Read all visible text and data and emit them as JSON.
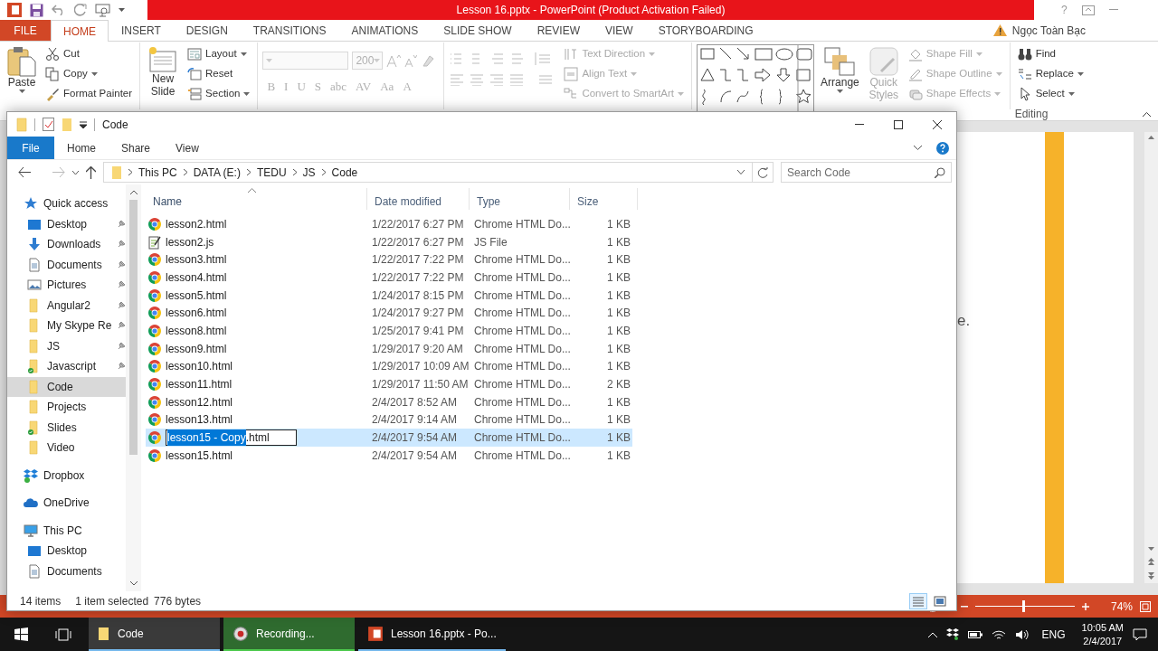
{
  "powerpoint": {
    "title": "Lesson 16.pptx - PowerPoint (Product Activation Failed)",
    "help": "?",
    "tabs": [
      {
        "label": "FILE",
        "kind": "backstage",
        "selected": false
      },
      {
        "label": "HOME",
        "kind": "tab",
        "selected": true
      },
      {
        "label": "INSERT",
        "kind": "tab",
        "selected": false
      },
      {
        "label": "DESIGN",
        "kind": "tab",
        "selected": false
      },
      {
        "label": "TRANSITIONS",
        "kind": "tab",
        "selected": false
      },
      {
        "label": "ANIMATIONS",
        "kind": "tab",
        "selected": false
      },
      {
        "label": "SLIDE SHOW",
        "kind": "tab",
        "selected": false
      },
      {
        "label": "REVIEW",
        "kind": "tab",
        "selected": false
      },
      {
        "label": "VIEW",
        "kind": "tab",
        "selected": false
      },
      {
        "label": "STORYBOARDING",
        "kind": "tab",
        "selected": false
      }
    ],
    "account": {
      "name": "Ngọc Toàn Bạc",
      "warning": true
    },
    "ribbon": {
      "clipboard": {
        "paste": "Paste",
        "commands": [
          {
            "label": "Cut",
            "kind": "cut",
            "menu": false,
            "disabled": false
          },
          {
            "label": "Copy",
            "kind": "copy",
            "menu": true,
            "disabled": false
          },
          {
            "label": "Format Painter",
            "kind": "brush",
            "menu": false,
            "disabled": false
          }
        ]
      },
      "slides": {
        "new_slide": "New Slide",
        "commands": [
          {
            "label": "Layout",
            "kind": "layout",
            "menu": true,
            "disabled": false
          },
          {
            "label": "Reset",
            "kind": "reset",
            "menu": false,
            "disabled": false
          },
          {
            "label": "Section",
            "kind": "section",
            "menu": true,
            "disabled": false
          }
        ]
      },
      "font": {
        "disabled": true,
        "size": "200",
        "formats": [
          "B",
          "I",
          "U",
          "S",
          "abc",
          "AV",
          "Aa",
          "A"
        ]
      },
      "paragraph": {
        "commands": [
          {
            "label": "Text Direction",
            "kind": "textdir",
            "menu": true,
            "disabled": true
          },
          {
            "label": "Align Text",
            "kind": "align",
            "menu": true,
            "disabled": true
          },
          {
            "label": "Convert to SmartArt",
            "kind": "smartart",
            "menu": true,
            "disabled": true
          }
        ]
      },
      "drawing": {
        "arrange": "Arrange",
        "quick_styles": "Quick Styles",
        "quick_styles_disabled": true,
        "commands": [
          {
            "label": "Shape Fill",
            "kind": "fill",
            "menu": true,
            "disabled": true
          },
          {
            "label": "Shape Outline",
            "kind": "outline",
            "menu": true,
            "disabled": true
          },
          {
            "label": "Shape Effects",
            "kind": "effects",
            "menu": true,
            "disabled": true
          }
        ]
      },
      "editing": {
        "label": "Editing",
        "commands": [
          {
            "label": "Find",
            "kind": "find",
            "menu": false,
            "disabled": false
          },
          {
            "label": "Replace",
            "kind": "replace",
            "menu": true,
            "disabled": false
          },
          {
            "label": "Select",
            "kind": "select",
            "menu": true,
            "disabled": false
          }
        ]
      }
    },
    "slide": {
      "text": "e."
    },
    "zoom": {
      "level": 0.48,
      "reading": "74%"
    }
  },
  "explorer": {
    "title": "Code",
    "tabs": [
      {
        "label": "File",
        "kind": "file",
        "selected": false
      },
      {
        "label": "Home",
        "kind": "tab",
        "selected": false
      },
      {
        "label": "Share",
        "kind": "tab",
        "selected": false
      },
      {
        "label": "View",
        "kind": "tab",
        "selected": false
      }
    ],
    "path": [
      "This PC",
      "DATA (E:)",
      "TEDU",
      "JS",
      "Code"
    ],
    "search": {
      "placeholder": "Search Code"
    },
    "nav": [
      {
        "label": "Quick access",
        "kind": "star",
        "selected": false,
        "children": [
          {
            "label": "Desktop",
            "kind": "desktop",
            "pinned": true,
            "selected": false
          },
          {
            "label": "Downloads",
            "kind": "download",
            "pinned": true,
            "selected": false
          },
          {
            "label": "Documents",
            "kind": "documents",
            "pinned": true,
            "selected": false
          },
          {
            "label": "Pictures",
            "kind": "pictures",
            "pinned": true,
            "selected": false
          },
          {
            "label": "Angular2",
            "kind": "folder",
            "pinned": true,
            "selected": false
          },
          {
            "label": "My Skype Re",
            "kind": "folder",
            "pinned": true,
            "selected": false
          },
          {
            "label": "JS",
            "kind": "folder",
            "pinned": true,
            "selected": false
          },
          {
            "label": "Javascript",
            "kind": "folder-synced",
            "pinned": true,
            "selected": false
          },
          {
            "label": "Code",
            "kind": "folder",
            "pinned": false,
            "selected": true
          },
          {
            "label": "Projects",
            "kind": "folder",
            "pinned": false,
            "selected": false
          },
          {
            "label": "Slides",
            "kind": "folder-synced",
            "pinned": false,
            "selected": false
          },
          {
            "label": "Video",
            "kind": "folder",
            "pinned": false,
            "selected": false
          }
        ]
      },
      {
        "label": "Dropbox",
        "kind": "dropbox",
        "selected": false
      },
      {
        "label": "OneDrive",
        "kind": "onedrive",
        "selected": false
      },
      {
        "label": "This PC",
        "kind": "pc",
        "selected": false,
        "children": [
          {
            "label": "Desktop",
            "kind": "desktop",
            "pinned": false,
            "selected": false
          },
          {
            "label": "Documents",
            "kind": "documents",
            "pinned": false,
            "selected": false
          }
        ]
      }
    ],
    "columns": [
      {
        "label": "Name",
        "sorted": true
      },
      {
        "label": "Date modified",
        "sorted": false
      },
      {
        "label": "Type",
        "sorted": false
      },
      {
        "label": "Size",
        "sorted": false
      }
    ],
    "rows": [
      {
        "kind": "html",
        "name": "lesson2.html",
        "date": "1/22/2017 6:27 PM",
        "type": "Chrome HTML Do...",
        "size": "1 KB",
        "selected": false
      },
      {
        "kind": "js",
        "name": "lesson2.js",
        "date": "1/22/2017 6:27 PM",
        "type": "JS File",
        "size": "1 KB",
        "selected": false
      },
      {
        "kind": "html",
        "name": "lesson3.html",
        "date": "1/22/2017 7:22 PM",
        "type": "Chrome HTML Do...",
        "size": "1 KB",
        "selected": false
      },
      {
        "kind": "html",
        "name": "lesson4.html",
        "date": "1/22/2017 7:22 PM",
        "type": "Chrome HTML Do...",
        "size": "1 KB",
        "selected": false
      },
      {
        "kind": "html",
        "name": "lesson5.html",
        "date": "1/24/2017 8:15 PM",
        "type": "Chrome HTML Do...",
        "size": "1 KB",
        "selected": false
      },
      {
        "kind": "html",
        "name": "lesson6.html",
        "date": "1/24/2017 9:27 PM",
        "type": "Chrome HTML Do...",
        "size": "1 KB",
        "selected": false
      },
      {
        "kind": "html",
        "name": "lesson8.html",
        "date": "1/25/2017 9:41 PM",
        "type": "Chrome HTML Do...",
        "size": "1 KB",
        "selected": false
      },
      {
        "kind": "html",
        "name": "lesson9.html",
        "date": "1/29/2017 9:20 AM",
        "type": "Chrome HTML Do...",
        "size": "1 KB",
        "selected": false
      },
      {
        "kind": "html",
        "name": "lesson10.html",
        "date": "1/29/2017 10:09 AM",
        "type": "Chrome HTML Do...",
        "size": "1 KB",
        "selected": false
      },
      {
        "kind": "html",
        "name": "lesson11.html",
        "date": "1/29/2017 11:50 AM",
        "type": "Chrome HTML Do...",
        "size": "2 KB",
        "selected": false
      },
      {
        "kind": "html",
        "name": "lesson12.html",
        "date": "2/4/2017 8:52 AM",
        "type": "Chrome HTML Do...",
        "size": "1 KB",
        "selected": false
      },
      {
        "kind": "html",
        "name": "lesson13.html",
        "date": "2/4/2017 9:14 AM",
        "type": "Chrome HTML Do...",
        "size": "1 KB",
        "selected": false
      },
      {
        "kind": "html",
        "edit": {
          "highlighted": "lesson15 - Copy",
          "rest": ".html"
        },
        "date": "2/4/2017 9:54 AM",
        "type": "Chrome HTML Do...",
        "size": "1 KB",
        "selected": true
      },
      {
        "kind": "html",
        "name": "lesson15.html",
        "date": "2/4/2017 9:54 AM",
        "type": "Chrome HTML Do...",
        "size": "1 KB",
        "selected": false
      }
    ],
    "status": {
      "count": "14 items",
      "selection": "1 item selected",
      "size": "776 bytes"
    },
    "views": [
      {
        "kind": "details",
        "selected": true
      },
      {
        "kind": "tiles",
        "selected": false
      }
    ]
  },
  "taskbar": {
    "apps": [
      {
        "label": "Code",
        "kind": "folder",
        "active": true,
        "highlighted": false
      },
      {
        "label": "Recording...",
        "kind": "recorder",
        "active": false,
        "highlighted": true
      },
      {
        "label": "Lesson 16.pptx - Po...",
        "kind": "ppt",
        "active": false,
        "highlighted": false
      }
    ],
    "language": "ENG",
    "time": "10:05 AM",
    "date": "2/4/2017"
  }
}
